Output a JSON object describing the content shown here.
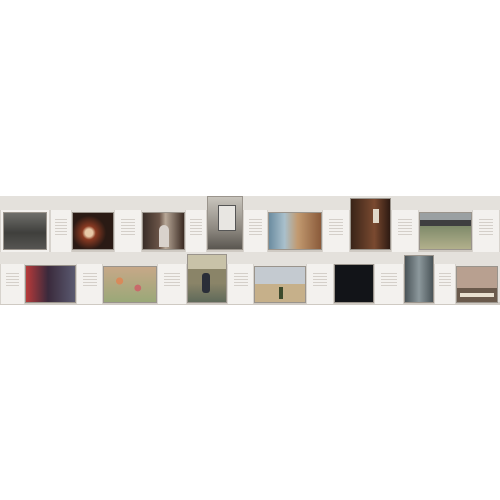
{
  "scene": {
    "subject": "",
    "background_color": "#ffffff",
    "wall_color": "#e4e1dc",
    "panel_color": "#f3f1ee"
  },
  "neon_sign": {
    "text": "",
    "color": "#4ff0ff"
  },
  "shop_sign": {
    "text": ""
  }
}
